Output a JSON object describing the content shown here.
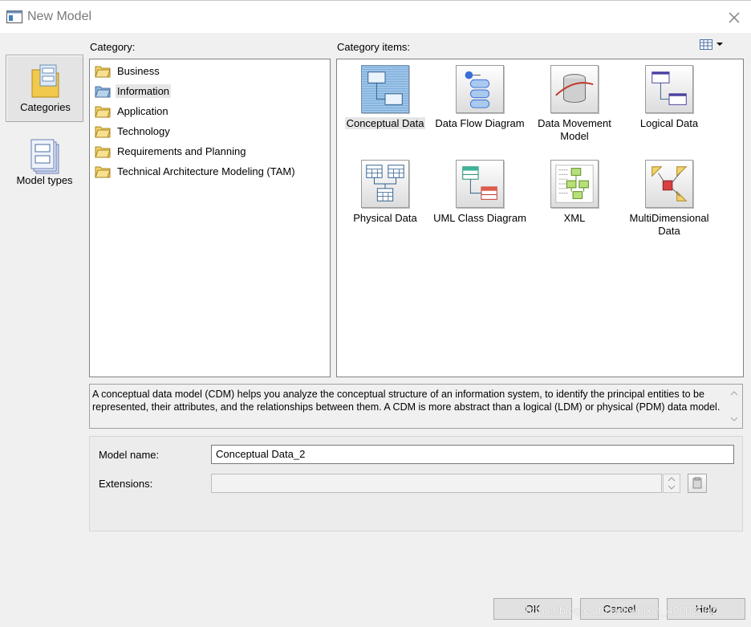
{
  "window": {
    "title": "New Model"
  },
  "nav": {
    "items": [
      {
        "label": "Categories",
        "icon": "categories-icon",
        "selected": true
      },
      {
        "label": "Model types",
        "icon": "model-types-icon",
        "selected": false
      }
    ]
  },
  "category": {
    "header": "Category:",
    "items": [
      {
        "label": "Business",
        "selected": false
      },
      {
        "label": "Information",
        "selected": true
      },
      {
        "label": "Application",
        "selected": false
      },
      {
        "label": "Technology",
        "selected": false
      },
      {
        "label": "Requirements and Planning",
        "selected": false
      },
      {
        "label": "Technical Architecture Modeling (TAM)",
        "selected": false
      }
    ]
  },
  "category_items": {
    "header": "Category items:",
    "items": [
      {
        "label": "Conceptual Data",
        "icon": "conceptual-data-icon",
        "selected": true
      },
      {
        "label": "Data Flow Diagram",
        "icon": "data-flow-diagram-icon",
        "selected": false
      },
      {
        "label": "Data Movement Model",
        "icon": "data-movement-model-icon",
        "selected": false
      },
      {
        "label": "Logical Data",
        "icon": "logical-data-icon",
        "selected": false
      },
      {
        "label": "Physical Data",
        "icon": "physical-data-icon",
        "selected": false
      },
      {
        "label": "UML Class Diagram",
        "icon": "uml-class-diagram-icon",
        "selected": false
      },
      {
        "label": "XML",
        "icon": "xml-icon",
        "selected": false
      },
      {
        "label": "MultiDimensional Data",
        "icon": "multidimensional-data-icon",
        "selected": false
      }
    ]
  },
  "description": "A conceptual data model (CDM) helps you analyze the conceptual structure of an information system, to identify the principal entities to be represented, their attributes, and the relationships between them. A CDM is more abstract than a logical (LDM) or physical (PDM) data model.",
  "form": {
    "model_name_label": "Model name:",
    "model_name_value": "Conceptual Data_2",
    "extensions_label": "Extensions:",
    "extensions_value": ""
  },
  "buttons": {
    "ok": "OK",
    "cancel": "Cancel",
    "help": "Help"
  },
  "watermark": "https://blog.csdn.net/weixin_40003002"
}
